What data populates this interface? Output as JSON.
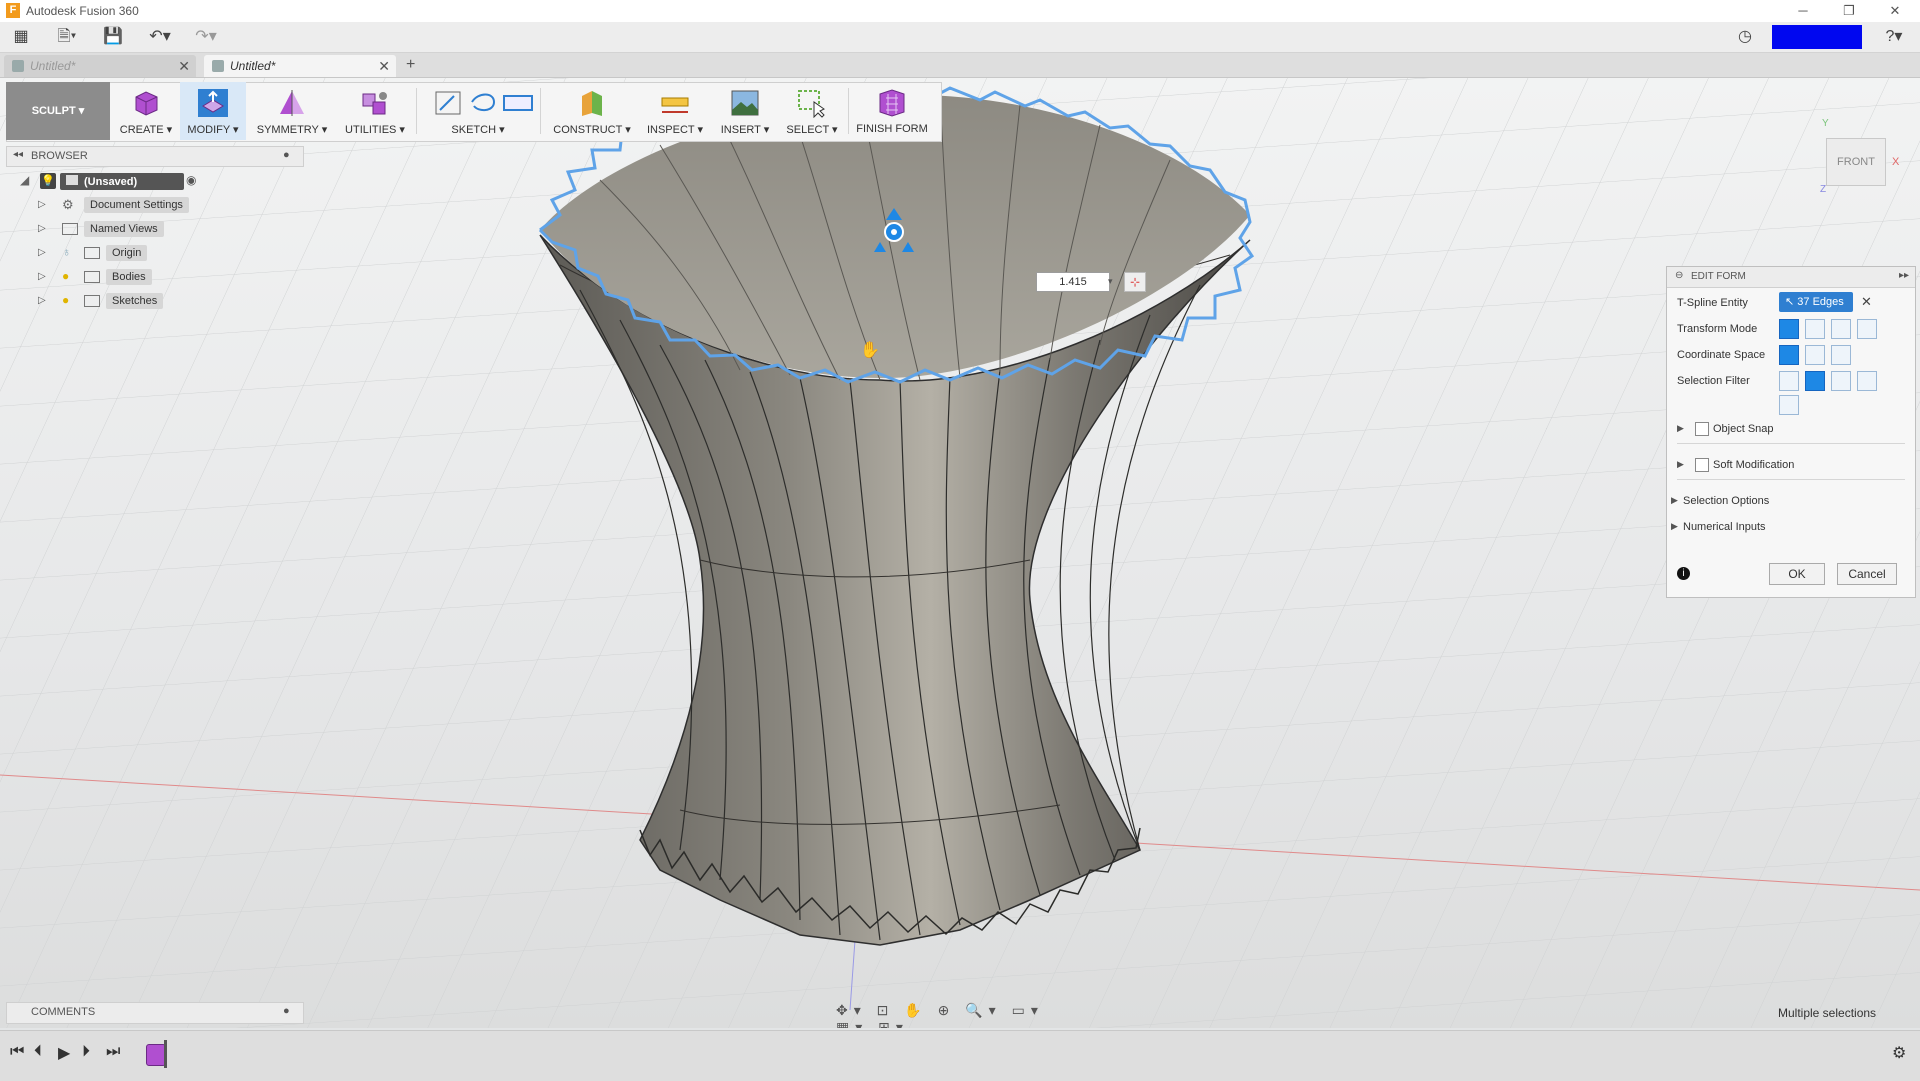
{
  "window": {
    "title": "Autodesk Fusion 360",
    "minimize": "─",
    "restore": "❐",
    "close": "✕"
  },
  "tabs": [
    {
      "label": "Untitled*"
    },
    {
      "label": "Untitled*"
    }
  ],
  "toolbar": {
    "workspace": "SCULPT ▾",
    "groups": [
      "CREATE ▾",
      "MODIFY ▾",
      "SYMMETRY ▾",
      "UTILITIES ▾",
      "SKETCH ▾",
      "CONSTRUCT ▾",
      "INSPECT ▾",
      "INSERT ▾",
      "SELECT ▾",
      "FINISH FORM"
    ]
  },
  "browser": {
    "header": "BROWSER",
    "root": "(Unsaved)",
    "items": [
      "Document Settings",
      "Named Views",
      "Origin",
      "Bodies",
      "Sketches"
    ]
  },
  "viewcube": {
    "face": "FRONT",
    "axis_x": "X",
    "axis_y": "Y",
    "axis_z": "Z"
  },
  "manipulator": {
    "value": "1.415"
  },
  "edit_form": {
    "title": "EDIT FORM",
    "tspline_entity_label": "T-Spline Entity",
    "tspline_entity_value": "37 Edges",
    "transform_mode_label": "Transform Mode",
    "coordinate_space_label": "Coordinate Space",
    "selection_filter_label": "Selection Filter",
    "object_snap": "Object Snap",
    "soft_modification": "Soft Modification",
    "selection_options": "Selection Options",
    "numerical_inputs": "Numerical Inputs",
    "ok": "OK",
    "cancel": "Cancel"
  },
  "comments": {
    "header": "COMMENTS"
  },
  "status": {
    "text": "Multiple selections"
  },
  "colors": {
    "accent": "#1e88e5",
    "selection_edge": "#5fa3e8",
    "user_box": "#0007f0"
  }
}
